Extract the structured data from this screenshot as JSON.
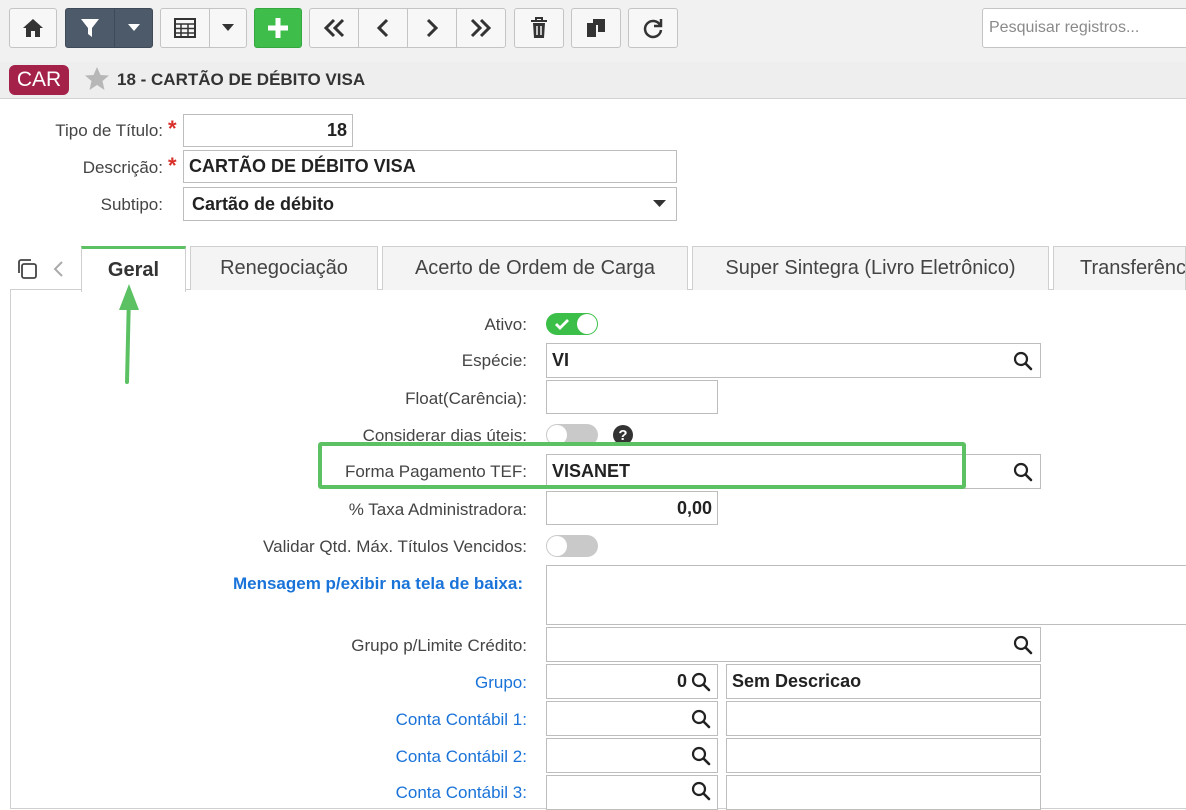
{
  "toolbar": {
    "search_placeholder": "Pesquisar registros...",
    "icons": [
      "home-icon",
      "filter-icon",
      "caret-down-icon",
      "grid-icon",
      "caret-down-icon",
      "plus-icon",
      "first-icon",
      "prev-icon",
      "next-icon",
      "last-icon",
      "trash-icon",
      "copy-icon",
      "refresh-icon"
    ]
  },
  "header": {
    "badge": "CAR",
    "title": "18 - CARTÃO DE DÉBITO VISA"
  },
  "form": {
    "tipo_label": "Tipo de Título:",
    "tipo_value": "18",
    "descricao_label": "Descrição:",
    "descricao_value": "CARTÃO DE DÉBITO VISA",
    "subtipo_label": "Subtipo:",
    "subtipo_value": "Cartão de débito",
    "required_mark": "*"
  },
  "tabs": [
    "Geral",
    "Renegociação",
    "Acerto de Ordem de Carga",
    "Super Sintegra (Livro Eletrônico)",
    "Transferência"
  ],
  "geral": {
    "ativo_label": "Ativo:",
    "especie_label": "Espécie:",
    "especie_value": "VI",
    "float_label": "Float(Carência):",
    "float_value": "",
    "dias_uteis_label": "Considerar dias úteis:",
    "help_glyph": "?",
    "forma_label": "Forma Pagamento TEF:",
    "forma_value": "VISANET",
    "taxa_label": "% Taxa Administradora:",
    "taxa_value": "0,00",
    "validar_label": "Validar Qtd. Máx. Títulos Vencidos:",
    "mensagem_label": "Mensagem p/exibir na tela de baixa:",
    "mensagem_value": "",
    "grupo_limite_label": "Grupo p/Limite Crédito:",
    "grupo_limite_value": "",
    "grupo_label": "Grupo:",
    "grupo_value": "0",
    "grupo_desc": "Sem Descricao",
    "conta1_label": "Conta Contábil 1:",
    "conta2_label": "Conta Contábil 2:",
    "conta3_label": "Conta Contábil 3:"
  },
  "toggles": {
    "ativo": true,
    "dias_uteis": false,
    "validar": false
  },
  "colors": {
    "accent_green": "#5cc163",
    "badge": "#a4224a",
    "link_blue": "#1a73d9",
    "required_red": "#d9302a"
  }
}
